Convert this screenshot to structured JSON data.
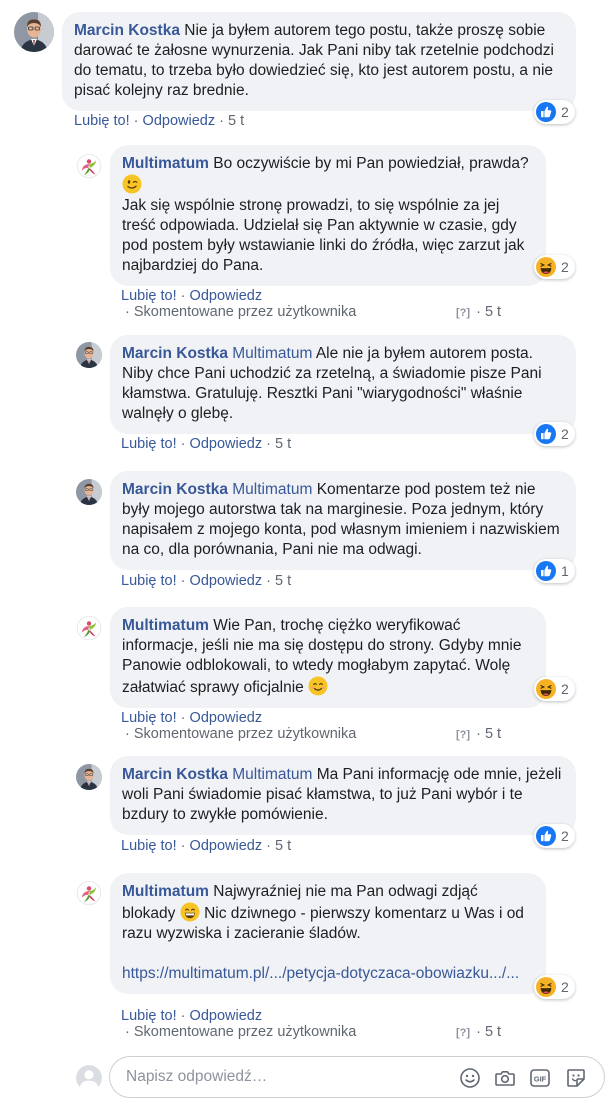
{
  "comments": [
    {
      "author": "Marcin Kostka",
      "mention": "",
      "text": "Nie ja byłem autorem tego postu, także proszę sobie darować te żałosne wynurzenia. Jak Pani niby tak rzetelnie podchodzi do tematu, to trzeba było dowiedzieć się, kto jest autorem postu, a nie pisać kolejny raz brednie.",
      "like": "Lubię to!",
      "reply": "Odpowiedz",
      "time": "5 t",
      "reaction": "like",
      "reaction_count": "2"
    },
    {
      "author": "Multimatum",
      "text_a": "Bo oczywiście by mi Pan powiedział, prawda?",
      "emoji_a": "wink",
      "text_b": "Jak się wspólnie stronę prowadzi, to się wspólnie za jej treść odpowiada. Udzielał się Pan aktywnie w czasie, gdy pod postem były wstawianie linki do źródła, więc zarzut jak najbardziej do Pana.",
      "like": "Lubię to!",
      "reply": "Odpowiedz",
      "edited": "Skomentowane przez użytkownika",
      "question_icon": "[?]",
      "time": "5 t",
      "reaction": "haha",
      "reaction_count": "2"
    },
    {
      "author": "Marcin Kostka",
      "mention": "Multimatum",
      "text": "Ale nie ja byłem autorem posta. Niby chce Pani uchodzić za rzetelną, a świadomie pisze Pani kłamstwa. Gratuluję. Resztki Pani \"wiarygodności\" właśnie walnęły o glebę.",
      "like": "Lubię to!",
      "reply": "Odpowiedz",
      "time": "5 t",
      "reaction": "like",
      "reaction_count": "2"
    },
    {
      "author": "Marcin Kostka",
      "mention": "Multimatum",
      "text": "Komentarze pod postem też nie były mojego autorstwa tak na marginesie. Poza jednym, który napisałem z mojego konta, pod własnym imieniem i nazwiskiem na co, dla porównania, Pani nie ma odwagi.",
      "like": "Lubię to!",
      "reply": "Odpowiedz",
      "time": "5 t",
      "reaction": "like",
      "reaction_count": "1"
    },
    {
      "author": "Multimatum",
      "text": "Wie Pan, trochę ciężko weryfikować informacje, jeśli nie ma się dostępu do strony. Gdyby mnie Panowie odblokowali, to wtedy mogłabym zapytać. Wolę załatwiać sprawy oficjalnie",
      "emoji": "smile",
      "like": "Lubię to!",
      "reply": "Odpowiedz",
      "edited": "Skomentowane przez użytkownika",
      "question_icon": "[?]",
      "time": "5 t",
      "reaction": "haha",
      "reaction_count": "2"
    },
    {
      "author": "Marcin Kostka",
      "mention": "Multimatum",
      "text": "Ma Pani informację ode mnie, jeżeli woli Pani świadomie pisać kłamstwa, to już Pani wybór i te bzdury to zwykłe pomówienie.",
      "like": "Lubię to!",
      "reply": "Odpowiedz",
      "time": "5 t",
      "reaction": "like",
      "reaction_count": "2"
    },
    {
      "author": "Multimatum",
      "text_a": "Najwyraźniej nie ma Pan odwagi zdjąć blokady",
      "emoji_a": "grin",
      "text_b": "Nic dziwnego - pierwszy komentarz u Was i od razu wyzwiska i zacieranie śladów.",
      "link": "https://multimatum.pl/.../petycja-dotyczaca-obowiazku.../...",
      "like": "Lubię to!",
      "reply": "Odpowiedz",
      "edited": "Skomentowane przez użytkownika",
      "question_icon": "[?]",
      "time": "5 t",
      "reaction": "haha",
      "reaction_count": "2"
    }
  ],
  "reply_box": {
    "placeholder": "Napisz odpowiedź…",
    "tools": [
      "emoji-icon",
      "camera-icon",
      "gif-icon",
      "sticker-icon"
    ]
  },
  "colors": {
    "link_blue": "#385898",
    "bubble_bg": "#f0f2f5",
    "meta_gray": "#606770",
    "like_blue": "#1877f2",
    "haha_yellow": "#f7b125"
  }
}
